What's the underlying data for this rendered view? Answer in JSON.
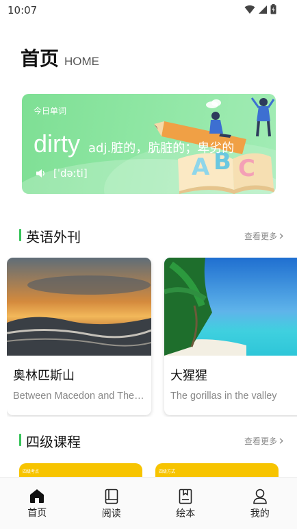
{
  "status_bar": {
    "time": "10:07"
  },
  "header": {
    "title": "首页",
    "subtitle": "HOME"
  },
  "word_card": {
    "label": "今日单词",
    "word": "dirty",
    "definition": "adj.脏的，肮脏的；卑劣的",
    "phonetic": "[ˈdəːti]"
  },
  "articles_section": {
    "title": "英语外刊",
    "more": "查看更多",
    "items": [
      {
        "title": "奥林匹斯山",
        "subtitle": "Between Macedon and Thessaly"
      },
      {
        "title": "大猩猩",
        "subtitle": "The gorillas in the valley"
      }
    ]
  },
  "courses_section": {
    "title": "四级课程",
    "more": "查看更多",
    "items": [
      {
        "tag": "四级考点"
      },
      {
        "tag": "四级方式"
      }
    ]
  },
  "tabbar": {
    "items": [
      {
        "label": "首页"
      },
      {
        "label": "阅读"
      },
      {
        "label": "绘本"
      },
      {
        "label": "我的"
      }
    ]
  }
}
